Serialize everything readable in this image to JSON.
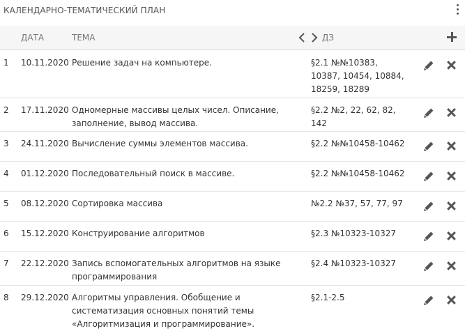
{
  "title": "КАЛЕНДАРНО-ТЕМАТИЧЕСКИЙ ПЛАН",
  "headers": {
    "date": "ДАТА",
    "topic": "ТЕМА",
    "homework": "ДЗ"
  },
  "rows": [
    {
      "num": "1",
      "date": "10.11.2020",
      "topic": "Решение задач на компьютере.",
      "homework": "§2.1 №№10383, 10387, 10454, 10884, 18259, 18289"
    },
    {
      "num": "2",
      "date": "17.11.2020",
      "topic": "Одномерные массивы целых чисел. Описание, заполнение, вывод массива.",
      "homework": "§2.2 №2, 22, 62, 82, 142"
    },
    {
      "num": "3",
      "date": "24.11.2020",
      "topic": "Вычисление суммы элементов массива.",
      "homework": "§2.2 №№10458-10462"
    },
    {
      "num": "4",
      "date": "01.12.2020",
      "topic": "Последовательный поиск в массиве.",
      "homework": "§2.2 №№10458-10462"
    },
    {
      "num": "5",
      "date": "08.12.2020",
      "topic": "Сортировка массива",
      "homework": "№2.2 №37, 57, 77, 97"
    },
    {
      "num": "6",
      "date": "15.12.2020",
      "topic": "Конструирование алгоритмов",
      "homework": "§2.3 №10323-10327"
    },
    {
      "num": "7",
      "date": "22.12.2020",
      "topic": "Запись вспомогательных алгоритмов на языке программирования",
      "homework": "§2.4 №10323-10327"
    },
    {
      "num": "8",
      "date": "29.12.2020",
      "topic": "Алгоритмы управления. Обобщение и систематизация основных понятий темы «Алгоритмизация и программирование».",
      "homework": "§2.1-2.5"
    }
  ],
  "icons": {
    "menu": "kebab-menu-icon",
    "toggle": "code-chevrons-icon",
    "add": "plus-icon",
    "edit": "pencil-icon",
    "delete": "close-icon"
  },
  "colors": {
    "icon": "#555555",
    "header_bg": "#f6f6f6",
    "divider": "#e3e3e3"
  }
}
